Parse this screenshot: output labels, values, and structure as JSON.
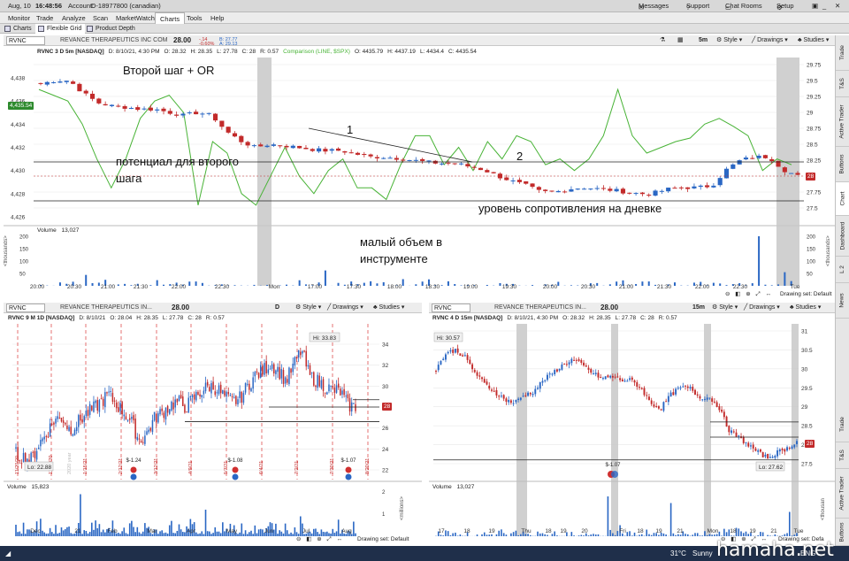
{
  "topbar": {
    "date": "Aug, 10",
    "time": "16:48:56",
    "account_label": "Account:",
    "account": "D-18977800 (canadian)",
    "messages": "Messages",
    "support": "Support",
    "chat": "Chat Rooms",
    "setup": "Setup"
  },
  "menu": [
    "Monitor",
    "Trade",
    "Analyze",
    "Scan",
    "MarketWatch",
    "Charts",
    "Tools",
    "Help"
  ],
  "subtabs": [
    "Charts",
    "Flexible Grid",
    "Product Depth"
  ],
  "main": {
    "symbol": "RVNC",
    "company": "REVANCE THERAPEUTICS INC COM",
    "price": "28.00",
    "change": "-.14",
    "change_pct": "-0.60%",
    "bid": "B: 27.77",
    "ask": "A: 29.13",
    "timeframe": "5m",
    "style": "Style",
    "drawings": "Drawings",
    "studies": "Studies",
    "info": [
      "RVNC 3 D 5m [NASDAQ]",
      "D: 8/10/21, 4:30 PM",
      "O: 28.32",
      "H: 28.35",
      "L: 27.78",
      "C: 28",
      "R: 0.57"
    ],
    "comparison": "Comparison (LINE, $SPX)",
    "cmp_ohlc": [
      "O: 4435.79",
      "H: 4437.19",
      "L: 4434.4",
      "C: 4435.54"
    ],
    "left_ticks": [
      "4,438",
      "4,436",
      "4,434",
      "4,432",
      "4,430",
      "4,428",
      "4,426"
    ],
    "left_badge": "4,435.54",
    "right_ticks": [
      "29.75",
      "29.5",
      "29.25",
      "29",
      "28.75",
      "28.5",
      "28.25",
      "28",
      "27.75",
      "27.5"
    ],
    "price_badge": "28",
    "volume_label": "Volume",
    "volume": "13,027",
    "vol_ticks": [
      "200",
      "150",
      "100",
      "50"
    ],
    "vol_axis": "<thousands>",
    "x_ticks": [
      "20:00",
      "20:30",
      "21:00",
      "21:30",
      "22:00",
      "22:30",
      "Mon",
      "17:00",
      "17:30",
      "18:00",
      "18:30",
      "19:00",
      "19:30",
      "20:00",
      "20:30",
      "21:00",
      "21:30",
      "22:00",
      "22:30",
      "Tue"
    ],
    "drawing_set": "Drawing set: Default",
    "annotations": {
      "step2": "Второй шаг + OR",
      "potential_1": "потенциал для второго",
      "potential_2": "шага",
      "one": "1",
      "two": "2",
      "resistance": "уровень сопротивления на дневке",
      "volume_1": "малый объем в",
      "volume_2": "инструменте"
    }
  },
  "sidebar": [
    "Trade",
    "T&S",
    "Active Trader",
    "Buttons",
    "Chart",
    "Dashboard",
    "L 2",
    "News"
  ],
  "left_chart": {
    "symbol": "RVNC",
    "company": "REVANCE THERAPEUTICS IN...",
    "price": "28.00",
    "timeframe": "D",
    "info": [
      "RVNC 9 M 1D [NASDAQ]",
      "D: 8/10/21",
      "O: 28.04",
      "H: 28.35",
      "L: 27.78",
      "C: 28",
      "R: 0.57"
    ],
    "hi": "Hi: 33.83",
    "lo": "Lo: 22.88",
    "right_ticks": [
      "34",
      "32",
      "30",
      "28",
      "26",
      "24",
      "22"
    ],
    "price_badge": "28",
    "events": [
      {
        "label": "$-1.24",
        "date": "2/25/21"
      },
      {
        "label": "$-1.08",
        "date": "5/6/21"
      },
      {
        "label": "$-1.07",
        "date": "8/5/21"
      }
    ],
    "dates": [
      "11/20/20",
      "12/18/20",
      "1/15/21",
      "2/12/21",
      "3/12/21",
      "4/9/21",
      "5/7/21",
      "6/4/21",
      "7/2/21",
      "7/30/21",
      "8/20/21"
    ],
    "year_label": "2020 year",
    "volume_label": "Volume",
    "volume": "15,823",
    "vol_axis": "<millions>",
    "x_ticks": [
      "Dec",
      "21",
      "Feb",
      "Mar",
      "Apr",
      "May",
      "Jun",
      "Jul",
      "Aug"
    ],
    "drawing_set": "Drawing set: Default"
  },
  "right_chart": {
    "symbol": "RVNC",
    "company": "REVANCE THERAPEUTICS IN...",
    "price": "28.00",
    "timeframe": "15m",
    "info": [
      "RVNC 4 D 15m [NASDAQ]",
      "D: 8/10/21, 4:30 PM",
      "O: 28.32",
      "H: 28.35",
      "L: 27.78",
      "C: 28",
      "R: 0.57"
    ],
    "hi": "Hi: 30.57",
    "lo": "Lo: 27.62",
    "right_ticks": [
      "31",
      "30.5",
      "30",
      "29.5",
      "29",
      "28.5",
      "28",
      "27.5"
    ],
    "price_badge": "28",
    "event": "$-1.07",
    "volume_label": "Volume",
    "volume": "13,027",
    "vol_axis": "<thousan",
    "x_ticks": [
      "17",
      "18",
      "19",
      "Thu",
      "18",
      "19",
      "20",
      "Fri",
      "18",
      "19",
      "21",
      "Mon",
      "18",
      "19",
      "21",
      "Tue"
    ],
    "drawing_set": "Drawing set: Defa"
  },
  "taskbar": {
    "temp": "31°C",
    "weather": "Sunny",
    "lang": "ENG"
  },
  "watermark": "hamaha.net",
  "colors": {
    "up": "#2a67c4",
    "down": "#c22a2a",
    "compare": "#48b336",
    "shade": "#c8c8c8"
  }
}
